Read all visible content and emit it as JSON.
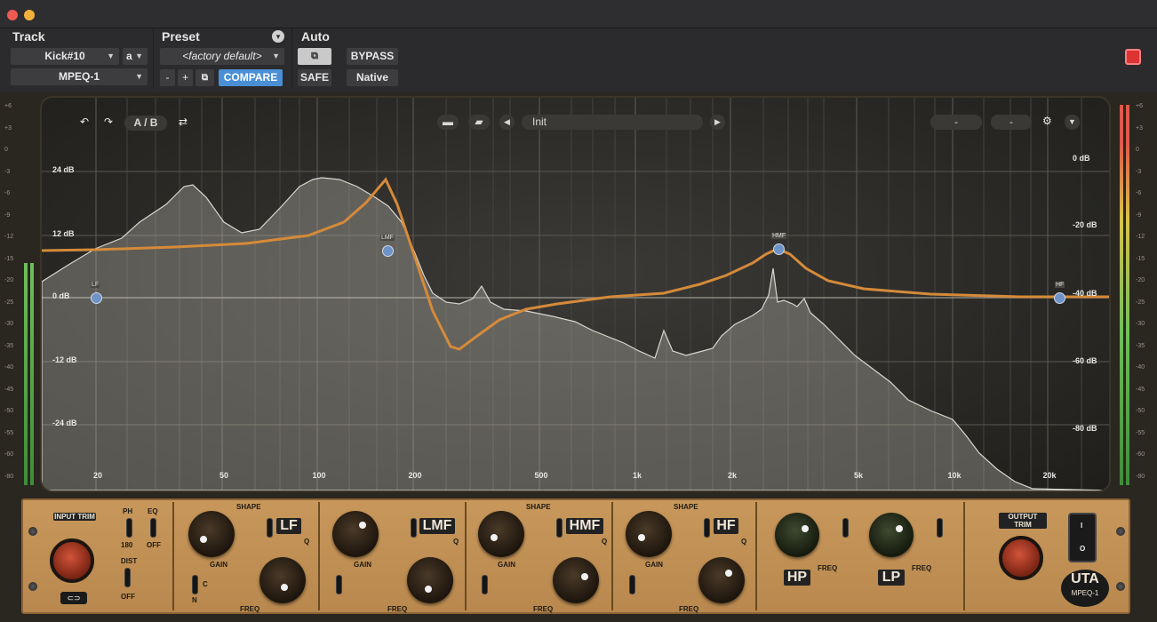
{
  "header": {
    "track_label": "Track",
    "preset_label": "Preset",
    "auto_label": "Auto",
    "track_name": "Kick#10",
    "track_channel": "a",
    "plugin_name": "MPEQ-1",
    "preset_name": "<factory default>",
    "minus": "-",
    "plus": "+",
    "compare": "COMPARE",
    "bypass": "BYPASS",
    "safe": "SAFE",
    "native": "Native"
  },
  "graph_toolbar": {
    "ab": "A / B",
    "preset_name": "Init",
    "slot1": "-",
    "slot2": "-"
  },
  "gain_left": [
    "24 dB",
    "12 dB",
    "0 dB",
    "-12 dB",
    "-24 dB"
  ],
  "gain_right": [
    "0 dB",
    "-20 dB",
    "-40 dB",
    "-60 dB",
    "-80 dB"
  ],
  "freq_ticks": [
    "20",
    "50",
    "100",
    "200",
    "500",
    "1k",
    "2k",
    "5k",
    "10k",
    "20k"
  ],
  "meter_scale": [
    "+6",
    "+3",
    "0",
    "-3",
    "-6",
    "-9",
    "-12",
    "-15",
    "-20",
    "-25",
    "-30",
    "-35",
    "-40",
    "-45",
    "-50",
    "-55",
    "-60",
    "-80"
  ],
  "bands": {
    "lf": "LF",
    "lmf": "LMF",
    "hmf": "HMF",
    "hf": "HF"
  },
  "nodes": {
    "lf": "LF",
    "lmf": "LMF",
    "hmf": "HMF",
    "hf": "HF"
  },
  "panel": {
    "input_trim": "INPUT TRIM",
    "output_trim": "OUTPUT TRIM",
    "ph": "PH",
    "eq": "EQ",
    "ph_val": "180",
    "eq_val": "OFF",
    "dist": "DIST",
    "dist_val": "OFF",
    "shape": "SHAPE",
    "gain": "GAIN",
    "freq": "FREQ",
    "q": "Q",
    "hp": "HP",
    "lp": "LP",
    "logo": "UTA",
    "model": "MPEQ-1",
    "c": "C",
    "n": "N",
    "o": "O",
    "i": "I"
  },
  "colors": {
    "accent": "#d58a3a",
    "compare": "#4a8fd6",
    "node": "#6f93c7"
  }
}
